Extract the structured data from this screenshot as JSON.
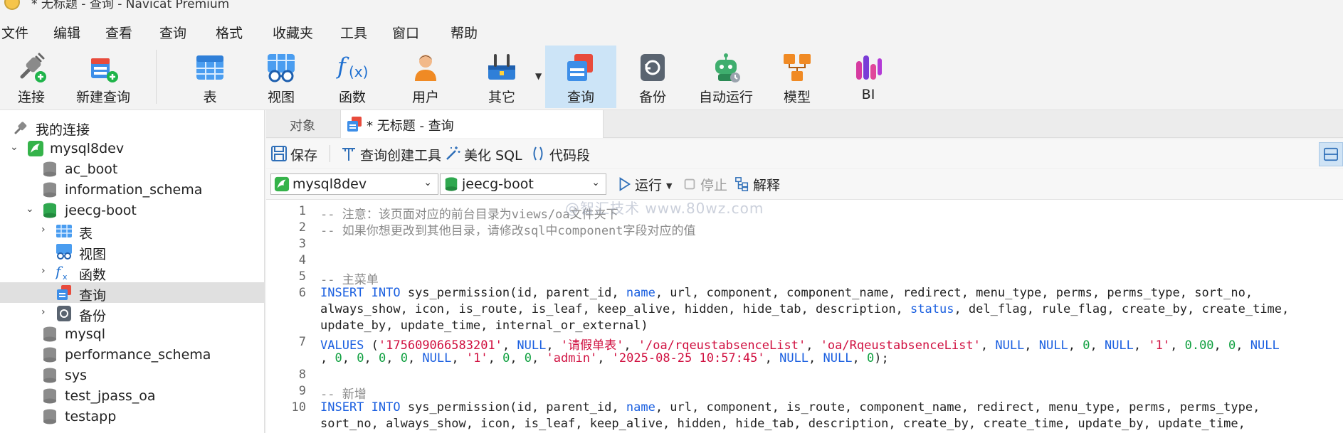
{
  "window": {
    "title": "* 无标题 - 查询 - Navicat Premium"
  },
  "menu": [
    "文件",
    "编辑",
    "查看",
    "查询",
    "格式",
    "收藏夹",
    "工具",
    "窗口",
    "帮助"
  ],
  "toolbar": {
    "connect": "连接",
    "new_query": "新建查询",
    "table": "表",
    "view": "视图",
    "function": "函数",
    "user": "用户",
    "other": "其它",
    "query": "查询",
    "backup": "备份",
    "automation": "自动运行",
    "model": "模型",
    "bi": "BI"
  },
  "sidebar": {
    "root": "我的连接",
    "connection": "mysql8dev",
    "db1": "ac_boot",
    "db2": "information_schema",
    "db3": "jeecg-boot",
    "tables": "表",
    "views": "视图",
    "functions": "函数",
    "queries": "查询",
    "backups": "备份",
    "db4": "mysql",
    "db5": "performance_schema",
    "db6": "sys",
    "db7": "test_jpass_oa",
    "db8": "testapp"
  },
  "tabs": {
    "objects": "对象",
    "query": "* 无标题 - 查询"
  },
  "query_toolbar": {
    "save": "保存",
    "builder": "查询创建工具",
    "beautify": "美化 SQL",
    "snippet": "代码段"
  },
  "selectors": {
    "connection": "mysql8dev",
    "database": "jeecg-boot",
    "run": "运行",
    "stop": "停止",
    "explain": "解释"
  },
  "watermark": "@智汇技术  www.80wz.com",
  "editor": {
    "line_numbers": [
      "1",
      "2",
      "3",
      "4",
      "5",
      "6",
      "",
      "",
      "7",
      "",
      "8",
      "9",
      "10",
      ""
    ],
    "l1": "-- 注意：该页面对应的前台目录为views/oa文件夹下",
    "l2": "-- 如果你想更改到其他目录，请修改sql中component字段对应的值",
    "l5": "-- 主菜单",
    "l6a_kw": "INSERT INTO",
    "l6a_1": " sys_permission(id, parent_id, ",
    "l6a_name": "name",
    "l6a_2": ", url, component, component_name, redirect, menu_type, perms, perms_type, sort_no,",
    "l6b_1": "always_show, icon, is_route, is_leaf, keep_alive, hidden, hide_tab, description, ",
    "l6b_status": "status",
    "l6b_2": ", del_flag, rule_flag, create_by, create_time,",
    "l6c": "update_by, update_time, internal_or_external)",
    "l7a_kw": "VALUES",
    "l7a_p1": " (",
    "l7a_s1": "'175609066583201'",
    "l7a_c1": ", ",
    "l7a_n1": "NULL",
    "l7a_c2": ", ",
    "l7a_s2": "'请假单表'",
    "l7a_c3": ", ",
    "l7a_s3": "'/oa/rqeustabsenceList'",
    "l7a_c4": ", ",
    "l7a_s4": "'oa/RqeustabsenceList'",
    "l7a_c5": ", ",
    "l7a_n2": "NULL",
    "l7a_c6": ", ",
    "l7a_n3": "NULL",
    "l7a_c7": ", ",
    "l7a_d1": "0",
    "l7a_c8": ", ",
    "l7a_n4": "NULL",
    "l7a_c9": ", ",
    "l7a_s5": "'1'",
    "l7a_c10": ", ",
    "l7a_d2": "0.00",
    "l7a_c11": ", ",
    "l7a_d3": "0",
    "l7a_c12": ", ",
    "l7a_n5": "NULL",
    "l7b_c0": ", ",
    "l7b_d1": "0",
    "l7b_c1": ", ",
    "l7b_d2": "0",
    "l7b_c2": ", ",
    "l7b_d3": "0",
    "l7b_c3": ", ",
    "l7b_d4": "0",
    "l7b_c4": ", ",
    "l7b_n1": "NULL",
    "l7b_c5": ", ",
    "l7b_s1": "'1'",
    "l7b_c6": ", ",
    "l7b_d5": "0",
    "l7b_c7": ", ",
    "l7b_d6": "0",
    "l7b_c8": ", ",
    "l7b_s2": "'admin'",
    "l7b_c9": ", ",
    "l7b_s3": "'2025-08-25 10:57:45'",
    "l7b_c10": ", ",
    "l7b_n2": "NULL",
    "l7b_c11": ", ",
    "l7b_n3": "NULL",
    "l7b_c12": ", ",
    "l7b_d7": "0",
    "l7b_end": ");",
    "l9": "-- 新增",
    "l10a_kw": "INSERT INTO",
    "l10a_1": " sys_permission(id, parent_id, ",
    "l10a_name": "name",
    "l10a_2": ", url, component, is_route, component_name, redirect, menu_type, perms, perms_type,",
    "l10b": "sort_no, always_show, icon, is_leaf, keep_alive, hidden, hide_tab, description, create_by, create_time, update_by, update_time,"
  }
}
